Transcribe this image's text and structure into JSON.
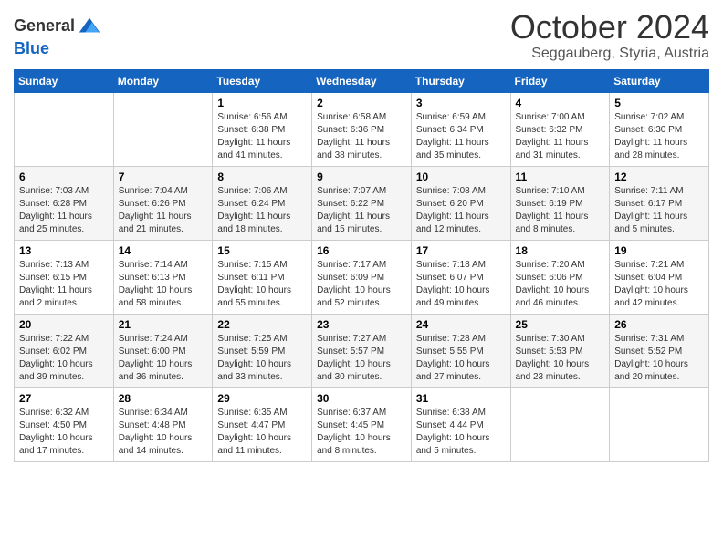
{
  "header": {
    "logo_general": "General",
    "logo_blue": "Blue",
    "month_title": "October 2024",
    "location": "Seggauberg, Styria, Austria"
  },
  "weekdays": [
    "Sunday",
    "Monday",
    "Tuesday",
    "Wednesday",
    "Thursday",
    "Friday",
    "Saturday"
  ],
  "weeks": [
    [
      {
        "day": "",
        "info": ""
      },
      {
        "day": "",
        "info": ""
      },
      {
        "day": "1",
        "info": "Sunrise: 6:56 AM\nSunset: 6:38 PM\nDaylight: 11 hours and 41 minutes."
      },
      {
        "day": "2",
        "info": "Sunrise: 6:58 AM\nSunset: 6:36 PM\nDaylight: 11 hours and 38 minutes."
      },
      {
        "day": "3",
        "info": "Sunrise: 6:59 AM\nSunset: 6:34 PM\nDaylight: 11 hours and 35 minutes."
      },
      {
        "day": "4",
        "info": "Sunrise: 7:00 AM\nSunset: 6:32 PM\nDaylight: 11 hours and 31 minutes."
      },
      {
        "day": "5",
        "info": "Sunrise: 7:02 AM\nSunset: 6:30 PM\nDaylight: 11 hours and 28 minutes."
      }
    ],
    [
      {
        "day": "6",
        "info": "Sunrise: 7:03 AM\nSunset: 6:28 PM\nDaylight: 11 hours and 25 minutes."
      },
      {
        "day": "7",
        "info": "Sunrise: 7:04 AM\nSunset: 6:26 PM\nDaylight: 11 hours and 21 minutes."
      },
      {
        "day": "8",
        "info": "Sunrise: 7:06 AM\nSunset: 6:24 PM\nDaylight: 11 hours and 18 minutes."
      },
      {
        "day": "9",
        "info": "Sunrise: 7:07 AM\nSunset: 6:22 PM\nDaylight: 11 hours and 15 minutes."
      },
      {
        "day": "10",
        "info": "Sunrise: 7:08 AM\nSunset: 6:20 PM\nDaylight: 11 hours and 12 minutes."
      },
      {
        "day": "11",
        "info": "Sunrise: 7:10 AM\nSunset: 6:19 PM\nDaylight: 11 hours and 8 minutes."
      },
      {
        "day": "12",
        "info": "Sunrise: 7:11 AM\nSunset: 6:17 PM\nDaylight: 11 hours and 5 minutes."
      }
    ],
    [
      {
        "day": "13",
        "info": "Sunrise: 7:13 AM\nSunset: 6:15 PM\nDaylight: 11 hours and 2 minutes."
      },
      {
        "day": "14",
        "info": "Sunrise: 7:14 AM\nSunset: 6:13 PM\nDaylight: 10 hours and 58 minutes."
      },
      {
        "day": "15",
        "info": "Sunrise: 7:15 AM\nSunset: 6:11 PM\nDaylight: 10 hours and 55 minutes."
      },
      {
        "day": "16",
        "info": "Sunrise: 7:17 AM\nSunset: 6:09 PM\nDaylight: 10 hours and 52 minutes."
      },
      {
        "day": "17",
        "info": "Sunrise: 7:18 AM\nSunset: 6:07 PM\nDaylight: 10 hours and 49 minutes."
      },
      {
        "day": "18",
        "info": "Sunrise: 7:20 AM\nSunset: 6:06 PM\nDaylight: 10 hours and 46 minutes."
      },
      {
        "day": "19",
        "info": "Sunrise: 7:21 AM\nSunset: 6:04 PM\nDaylight: 10 hours and 42 minutes."
      }
    ],
    [
      {
        "day": "20",
        "info": "Sunrise: 7:22 AM\nSunset: 6:02 PM\nDaylight: 10 hours and 39 minutes."
      },
      {
        "day": "21",
        "info": "Sunrise: 7:24 AM\nSunset: 6:00 PM\nDaylight: 10 hours and 36 minutes."
      },
      {
        "day": "22",
        "info": "Sunrise: 7:25 AM\nSunset: 5:59 PM\nDaylight: 10 hours and 33 minutes."
      },
      {
        "day": "23",
        "info": "Sunrise: 7:27 AM\nSunset: 5:57 PM\nDaylight: 10 hours and 30 minutes."
      },
      {
        "day": "24",
        "info": "Sunrise: 7:28 AM\nSunset: 5:55 PM\nDaylight: 10 hours and 27 minutes."
      },
      {
        "day": "25",
        "info": "Sunrise: 7:30 AM\nSunset: 5:53 PM\nDaylight: 10 hours and 23 minutes."
      },
      {
        "day": "26",
        "info": "Sunrise: 7:31 AM\nSunset: 5:52 PM\nDaylight: 10 hours and 20 minutes."
      }
    ],
    [
      {
        "day": "27",
        "info": "Sunrise: 6:32 AM\nSunset: 4:50 PM\nDaylight: 10 hours and 17 minutes."
      },
      {
        "day": "28",
        "info": "Sunrise: 6:34 AM\nSunset: 4:48 PM\nDaylight: 10 hours and 14 minutes."
      },
      {
        "day": "29",
        "info": "Sunrise: 6:35 AM\nSunset: 4:47 PM\nDaylight: 10 hours and 11 minutes."
      },
      {
        "day": "30",
        "info": "Sunrise: 6:37 AM\nSunset: 4:45 PM\nDaylight: 10 hours and 8 minutes."
      },
      {
        "day": "31",
        "info": "Sunrise: 6:38 AM\nSunset: 4:44 PM\nDaylight: 10 hours and 5 minutes."
      },
      {
        "day": "",
        "info": ""
      },
      {
        "day": "",
        "info": ""
      }
    ]
  ]
}
